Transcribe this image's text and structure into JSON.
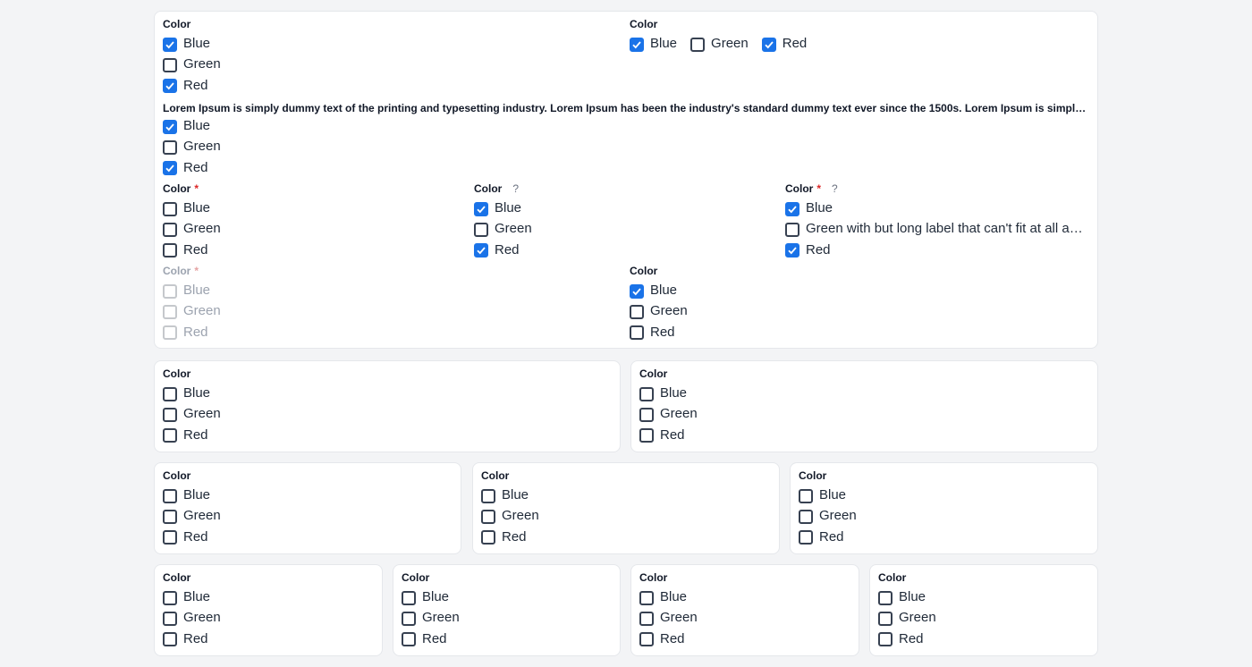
{
  "label": "Color",
  "long_label": "Lorem Ipsum is simply dummy text of the printing and typesetting industry. Lorem Ipsum has been the industry's standard dummy text ever since the 1500s. Lorem Ipsum is simply dummy text of the printing and typesetting industry.",
  "required_mark": "*",
  "help_mark": "?",
  "options": [
    "Blue",
    "Green",
    "Red"
  ],
  "long_option": "Green with but long label that can't fit at all and will be truncated with ellipsis",
  "colors": {
    "accent": "#1a73e8",
    "required": "#dc2626",
    "border": "#e5e7eb",
    "background": "#f3f4f6"
  },
  "groups": {
    "a": {
      "checked": [
        true,
        false,
        true
      ]
    },
    "b": {
      "checked": [
        true,
        false,
        true
      ]
    },
    "c": {
      "checked": [
        true,
        false,
        true
      ]
    },
    "d": {
      "checked": [
        false,
        false,
        false
      ]
    },
    "e": {
      "checked": [
        true,
        false,
        true
      ]
    },
    "f": {
      "checked": [
        true,
        false,
        true
      ]
    },
    "g": {
      "checked": [
        false,
        false,
        false
      ]
    },
    "h": {
      "checked": [
        true,
        false,
        false
      ]
    }
  }
}
